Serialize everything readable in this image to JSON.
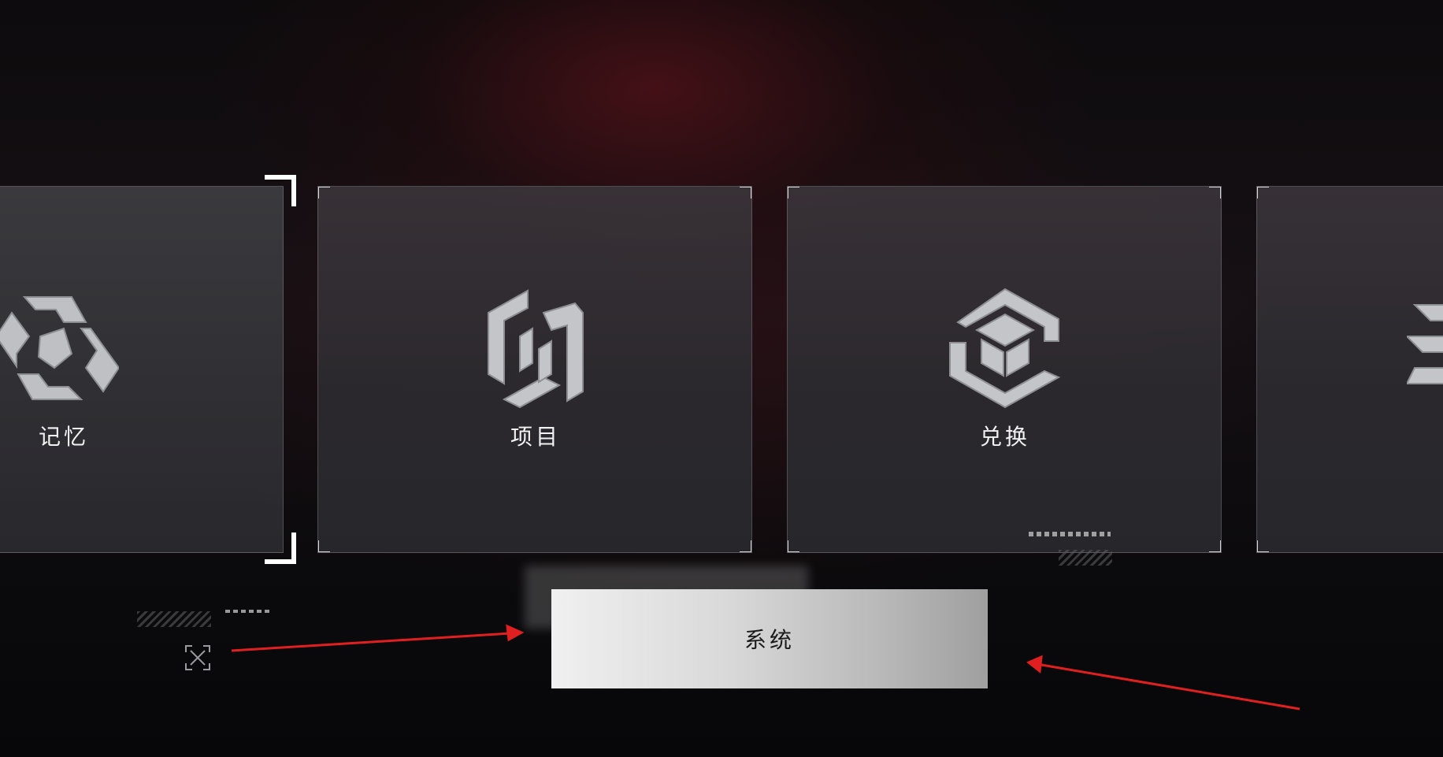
{
  "menu": {
    "cards": [
      {
        "id": "memory",
        "label": "记忆",
        "icon": "memory-emblem-icon"
      },
      {
        "id": "project",
        "label": "项目",
        "icon": "project-emblem-icon"
      },
      {
        "id": "exchange",
        "label": "兑换",
        "icon": "exchange-emblem-icon"
      },
      {
        "id": "partial",
        "label": "",
        "icon": "partial-emblem-icon"
      }
    ],
    "system_button": "系统"
  },
  "icons": {
    "fullscreen": "fullscreen-icon",
    "annotation_arrows": "red-arrow-icon"
  },
  "colors": {
    "accent_red": "#e02020",
    "card_text": "#f2f2f2",
    "button_bg": "#d9d9d9"
  }
}
